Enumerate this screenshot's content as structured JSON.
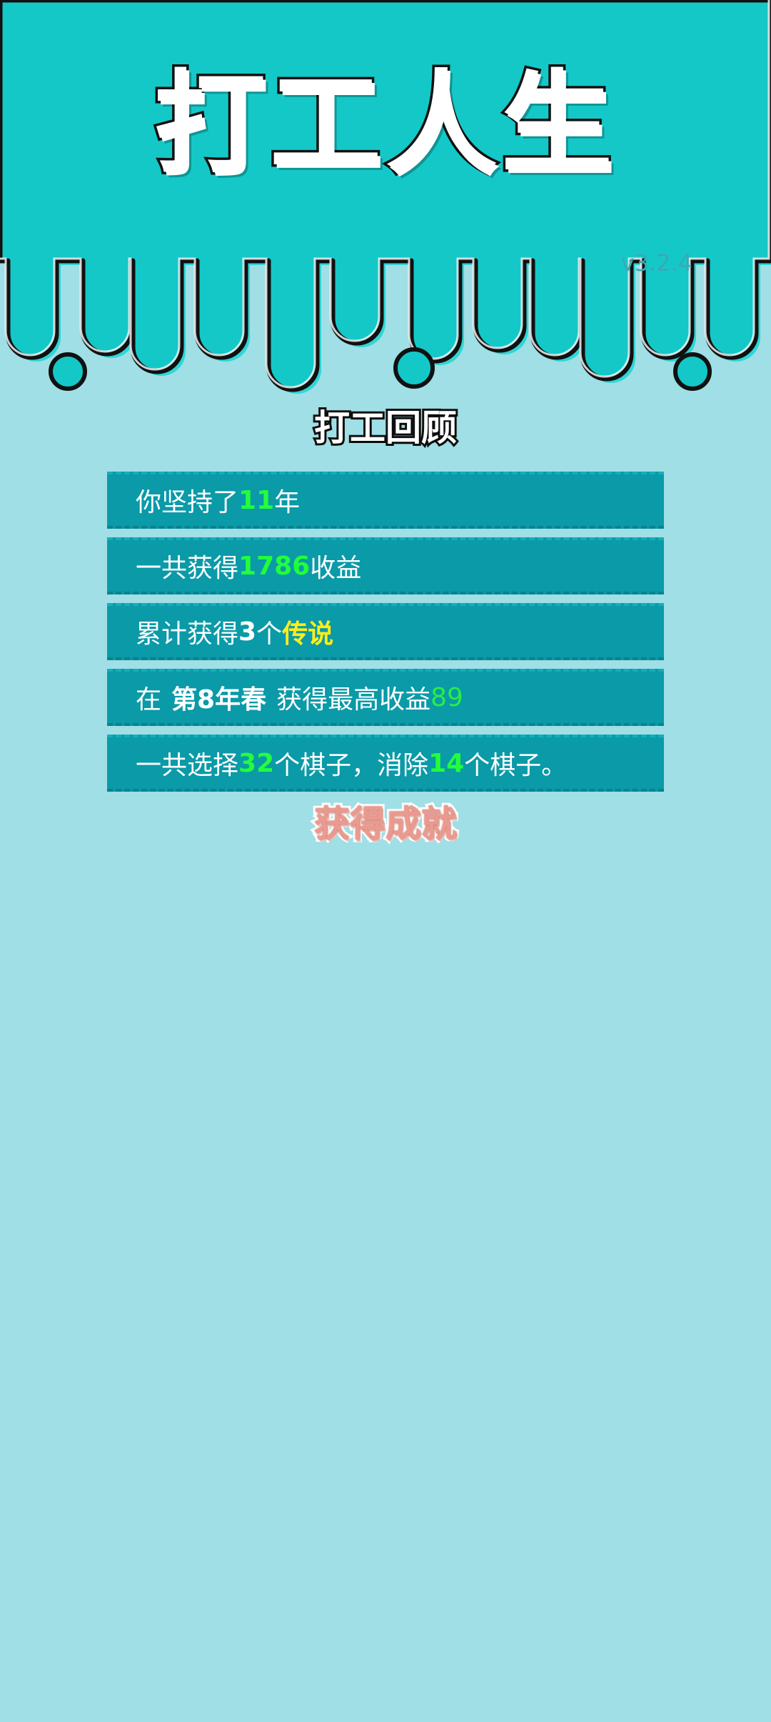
{
  "header": {
    "title": "打工人生",
    "version": "v3.2.4"
  },
  "review": {
    "heading": "打工回顾",
    "rows": [
      {
        "prefix": "你坚持了",
        "value": "11",
        "suffix": "年"
      },
      {
        "prefix": "一共获得",
        "value": "1786",
        "suffix": "收益"
      },
      {
        "prefix": "累计获得",
        "value": "3",
        "middle": "个",
        "tag": "传说"
      },
      {
        "prefix": "在",
        "season": "第8年春",
        "middle": "获得最高收益",
        "value": "89"
      },
      {
        "prefix": "一共选择",
        "value": "32",
        "middle": "个棋子，消除",
        "value2": "14",
        "suffix": "个棋子。"
      }
    ]
  },
  "achievements": {
    "heading": "获得成就"
  },
  "colors": {
    "top_banner": "#14c8c8",
    "background": "#9fdfe5",
    "row_background": "#0a9aa8",
    "highlight_green": "#22ff3a",
    "highlight_yellow": "#ffee1a",
    "achievement_heading": "#ea9a8e"
  }
}
